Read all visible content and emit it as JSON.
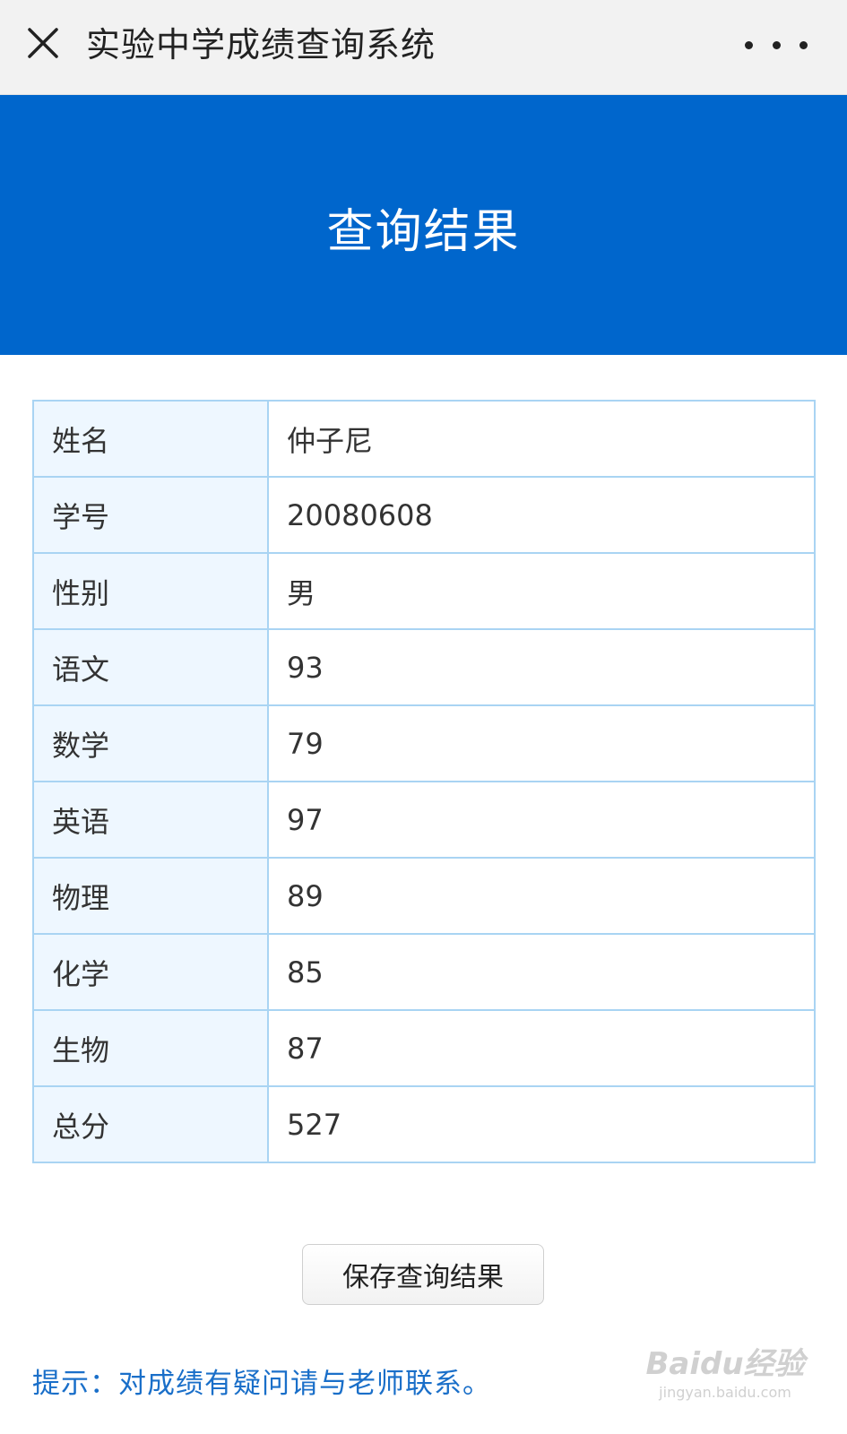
{
  "header": {
    "title": "实验中学成绩查询系统",
    "close_icon": "close-icon",
    "more_icon": "more-icon"
  },
  "banner": {
    "title": "查询结果"
  },
  "results": [
    {
      "label": "姓名",
      "value": "仲子尼"
    },
    {
      "label": "学号",
      "value": "20080608"
    },
    {
      "label": "性别",
      "value": "男"
    },
    {
      "label": "语文",
      "value": "93"
    },
    {
      "label": "数学",
      "value": "79"
    },
    {
      "label": "英语",
      "value": "97"
    },
    {
      "label": "物理",
      "value": "89"
    },
    {
      "label": "化学",
      "value": "85"
    },
    {
      "label": "生物",
      "value": "87"
    },
    {
      "label": "总分",
      "value": "527"
    }
  ],
  "save_button": {
    "label": "保存查询结果"
  },
  "hint": {
    "text": "提示：对成绩有疑问请与老师联系。"
  },
  "watermark": {
    "brand": "Baidu经验",
    "url": "jingyan.baidu.com"
  },
  "colors": {
    "banner": "#0066cc",
    "table_border": "#a9d4f3",
    "label_cell_bg": "#eef7ff",
    "hint_text": "#1a6fc9"
  }
}
